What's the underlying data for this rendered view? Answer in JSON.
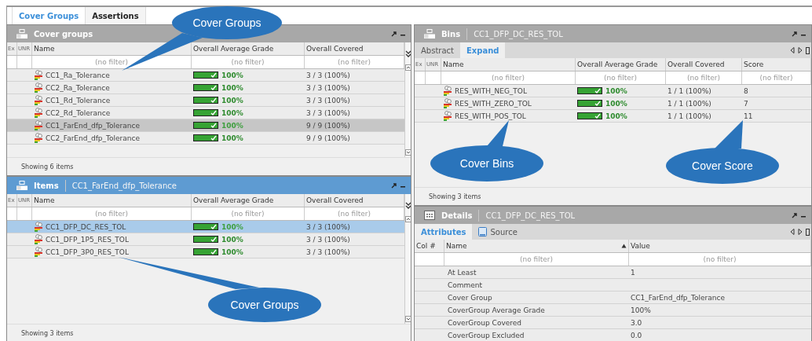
{
  "tabs": [
    {
      "label": "Cover Groups",
      "selected": true
    },
    {
      "label": "Assertions",
      "selected": false
    }
  ],
  "cover_groups_panel": {
    "title": "Cover groups",
    "active": false,
    "scrollbar": true,
    "columns": [
      {
        "kind": "ex",
        "label": "Ex"
      },
      {
        "kind": "unr",
        "label": "UNR"
      },
      {
        "kind": "name",
        "label": "Name",
        "placeholder": "(no filter)"
      },
      {
        "kind": "grade",
        "label": "Overall Average Grade",
        "placeholder": "(no filter)"
      },
      {
        "kind": "covered",
        "label": "Overall Covered",
        "placeholder": "(no filter)"
      }
    ],
    "rows": [
      {
        "name": "CC1_Ra_Tolerance",
        "level": 1,
        "grade": "100%",
        "covered": "3 / 3 (100%)",
        "selected": false
      },
      {
        "name": "CC2_Ra_Tolerance",
        "level": 1,
        "grade": "100%",
        "covered": "3 / 3 (100%)",
        "selected": false
      },
      {
        "name": "CC1_Rd_Tolerance",
        "level": 1,
        "grade": "100%",
        "covered": "3 / 3 (100%)",
        "selected": false
      },
      {
        "name": "CC2_Rd_Tolerance",
        "level": 1,
        "grade": "100%",
        "covered": "3 / 3 (100%)",
        "selected": false
      },
      {
        "name": "CC1_FarEnd_dfp_Tolerance",
        "level": 1,
        "grade": "100%",
        "covered": "9 / 9 (100%)",
        "selected": true
      },
      {
        "name": "CC2_FarEnd_dfp_Tolerance",
        "level": 1,
        "grade": "100%",
        "covered": "9 / 9 (100%)",
        "selected": false
      }
    ],
    "status": "Showing 6 items"
  },
  "items_panel": {
    "title": "Items",
    "subtitle": "CC1_FarEnd_dfp_Tolerance",
    "active": true,
    "scrollbar": true,
    "columns": [
      {
        "kind": "ex",
        "label": "Ex"
      },
      {
        "kind": "unr",
        "label": "UNR"
      },
      {
        "kind": "name",
        "label": "Name",
        "placeholder": "(no filter)"
      },
      {
        "kind": "grade",
        "label": "Overall Average Grade",
        "placeholder": "(no filter)"
      },
      {
        "kind": "covered",
        "label": "Overall Covered",
        "placeholder": "(no filter)"
      }
    ],
    "rows": [
      {
        "name": "CC1_DFP_DC_RES_TOL",
        "level": 1,
        "grade": "100%",
        "covered": "3 / 3 (100%)",
        "selected": true
      },
      {
        "name": "CC1_DFP_1P5_RES_TOL",
        "level": 1,
        "grade": "100%",
        "covered": "3 / 3 (100%)",
        "selected": false
      },
      {
        "name": "CC1_DFP_3P0_RES_TOL",
        "level": 1,
        "grade": "100%",
        "covered": "3 / 3 (100%)",
        "selected": false
      }
    ],
    "status": "Showing 3 items"
  },
  "bins_panel": {
    "title": "Bins",
    "subtitle": "CC1_DFP_DC_RES_TOL",
    "active": false,
    "scrollbar": false,
    "subtabs": [
      {
        "label": "Abstract",
        "kind": "plain",
        "selected": false
      },
      {
        "label": "Expand",
        "kind": "plain",
        "selected": true
      }
    ],
    "columns": [
      {
        "kind": "ex",
        "label": "Ex"
      },
      {
        "kind": "unr",
        "label": "UNR"
      },
      {
        "kind": "name",
        "label": "Name",
        "placeholder": "(no filter)"
      },
      {
        "kind": "grade",
        "label": "Overall Average Grade",
        "placeholder": "(no filter)"
      },
      {
        "kind": "covered",
        "label": "Overall Covered",
        "placeholder": "(no filter)"
      },
      {
        "kind": "score",
        "label": "Score",
        "placeholder": "(no filter)"
      }
    ],
    "rows": [
      {
        "name": "RES_WITH_NEG_TOL",
        "level": 1,
        "grade": "100%",
        "covered": "1 / 1 (100%)",
        "score": "8",
        "selected": false
      },
      {
        "name": "RES_WITH_ZERO_TOL",
        "level": 1,
        "grade": "100%",
        "covered": "1 / 1 (100%)",
        "score": "7",
        "selected": false
      },
      {
        "name": "RES_WITH_POS_TOL",
        "level": 1,
        "grade": "100%",
        "covered": "1 / 1 (100%)",
        "score": "11",
        "selected": false
      }
    ],
    "status": "Showing 3 items"
  },
  "details_panel": {
    "title": "Details",
    "subtitle": "CC1_DFP_DC_RES_TOL",
    "active": false,
    "scrollbar": false,
    "subtabs": [
      {
        "label": "Attributes",
        "kind": "plain",
        "selected": true
      },
      {
        "label": "Source",
        "kind": "file",
        "selected": false
      }
    ],
    "columns": [
      {
        "kind": "col",
        "label": "Col #"
      },
      {
        "kind": "attr",
        "label": "Name",
        "sorted": true,
        "placeholder": "(no filter)"
      },
      {
        "kind": "value",
        "label": "Value",
        "placeholder": "(no filter)"
      }
    ],
    "rows": [
      {
        "attr": "At Least",
        "value": "1"
      },
      {
        "attr": "Comment"
      },
      {
        "attr": "Cover Group",
        "value": "CC1_FarEnd_dfp_Tolerance"
      },
      {
        "attr": "CoverGroup Average Grade",
        "value": "100%"
      },
      {
        "attr": "CoverGroup Covered",
        "value": "3.0"
      },
      {
        "attr": "CoverGroup Excluded",
        "value": "0.0"
      }
    ]
  },
  "callouts": [
    {
      "text": "Cover Groups"
    },
    {
      "text": "Cover Groups"
    },
    {
      "text": "Cover Bins"
    },
    {
      "text": "Cover Score"
    }
  ]
}
